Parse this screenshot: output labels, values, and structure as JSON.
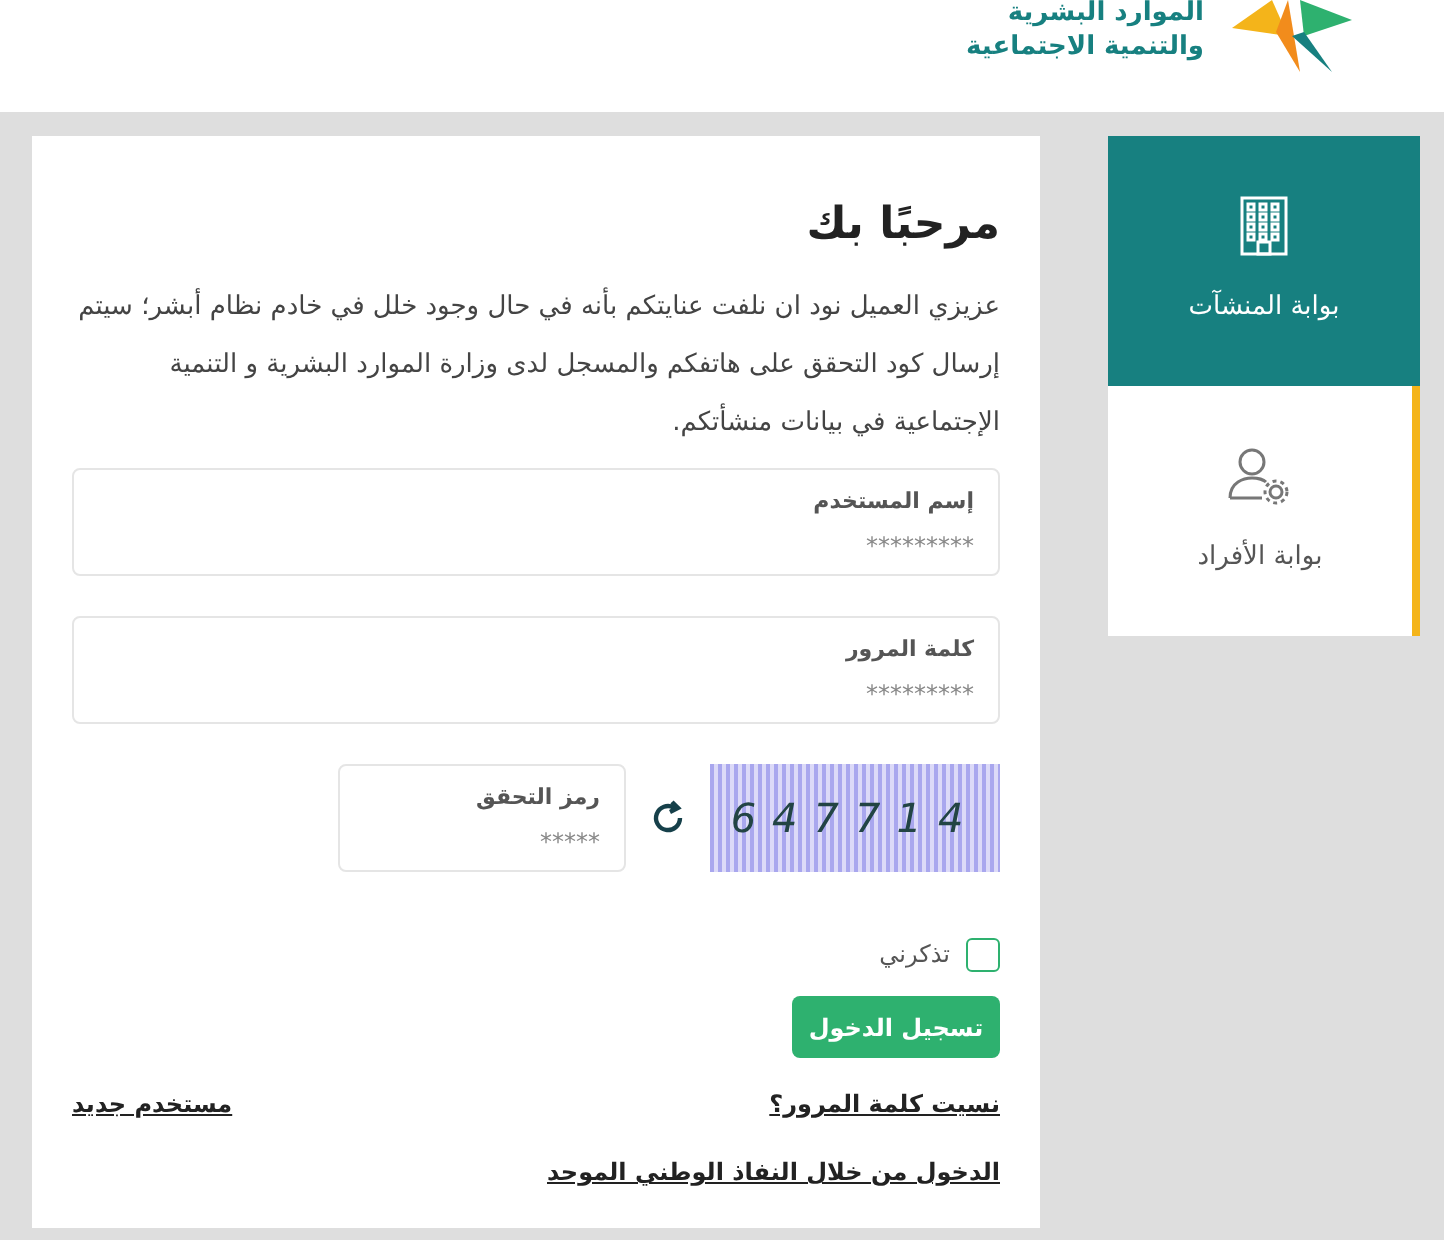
{
  "header": {
    "logo_lines": [
      "الموارد البشرية",
      "والتنمية الاجتماعية"
    ]
  },
  "portals": [
    {
      "label": "بوابة المنشآت",
      "kind": "business",
      "selected": true
    },
    {
      "label": "بوابة الأفراد",
      "kind": "individual",
      "selected": false
    }
  ],
  "login": {
    "title": "مرحبًا بك",
    "notice": "عزيزي العميل نود ان نلفت عنايتكم بأنه في حال وجود خلل في خادم نظام أبشر؛ سيتم إرسال كود التحقق على هاتفكم والمسجل لدى وزارة الموارد البشرية و التنمية الإجتماعية في بيانات منشأتكم.",
    "fields": [
      {
        "label": "إسم المستخدم",
        "placeholder": "*********"
      },
      {
        "label": "كلمة المرور",
        "placeholder": "*********"
      }
    ],
    "captcha": {
      "label": "رمز التحقق",
      "placeholder": "*****",
      "code": "647714"
    },
    "remember": {
      "label": "تذكرني",
      "checked": false
    },
    "submit": "تسجيل الدخول",
    "forgot_link": "نسيت كلمة المرور؟",
    "new_user_link": "مستخدم جديد",
    "sso_link": "الدخول من خلال النفاذ الوطني الموحد"
  }
}
